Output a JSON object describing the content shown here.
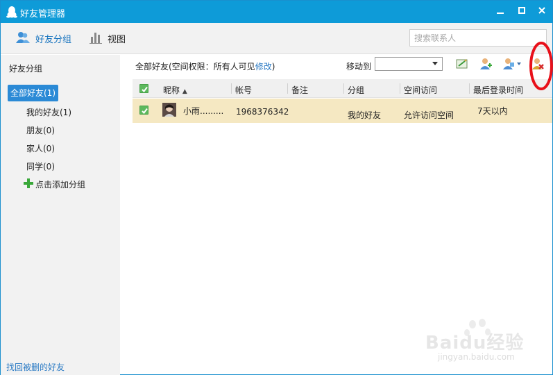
{
  "window": {
    "title": "好友管理器",
    "controls": {
      "minimize": "−",
      "maximize": "□",
      "close": "×"
    }
  },
  "toolbar": {
    "groups_label": "好友分组",
    "view_label": "视图",
    "search_placeholder": "搜索联系人"
  },
  "sidebar": {
    "title": "好友分组",
    "groups": [
      {
        "label": "全部好友(1)",
        "selected": true
      },
      {
        "label": "我的好友(1)"
      },
      {
        "label": "朋友(0)"
      },
      {
        "label": "家人(0)"
      },
      {
        "label": "同学(0)"
      }
    ],
    "add_group_label": "点击添加分组",
    "recover_link": "找回被删的好友"
  },
  "main": {
    "header_text": "全部好友(空间权限：所有人可见",
    "header_edit_link": "修改",
    "header_close": ")",
    "moveto_label": "移动到",
    "moveto_value": "",
    "actions": [
      {
        "icon": "edit-note-icon"
      },
      {
        "icon": "add-friend-icon"
      },
      {
        "icon": "friend-menu-icon"
      },
      {
        "icon": "delete-friend-icon"
      }
    ]
  },
  "table": {
    "columns": [
      "昵称",
      "帐号",
      "备注",
      "分组",
      "空间访问",
      "最后登录时间"
    ],
    "sort_indicator": "▲",
    "rows": [
      {
        "checked": true,
        "nickname": "小雨.........",
        "account": "1968376342",
        "remark": "",
        "group": "我的好友",
        "space_access": "允许访问空间",
        "last_login": "7天以内"
      }
    ]
  },
  "watermark": {
    "text": "Baidu经验",
    "sub": "jingyan.baidu.com"
  },
  "colors": {
    "titlebar": "#0e9bd8",
    "selected_group": "#2b8ad6",
    "selected_row": "#f5e8c2",
    "link": "#2a7ac4",
    "checkbox": "#5cb85c",
    "annotation": "#e8101a"
  }
}
